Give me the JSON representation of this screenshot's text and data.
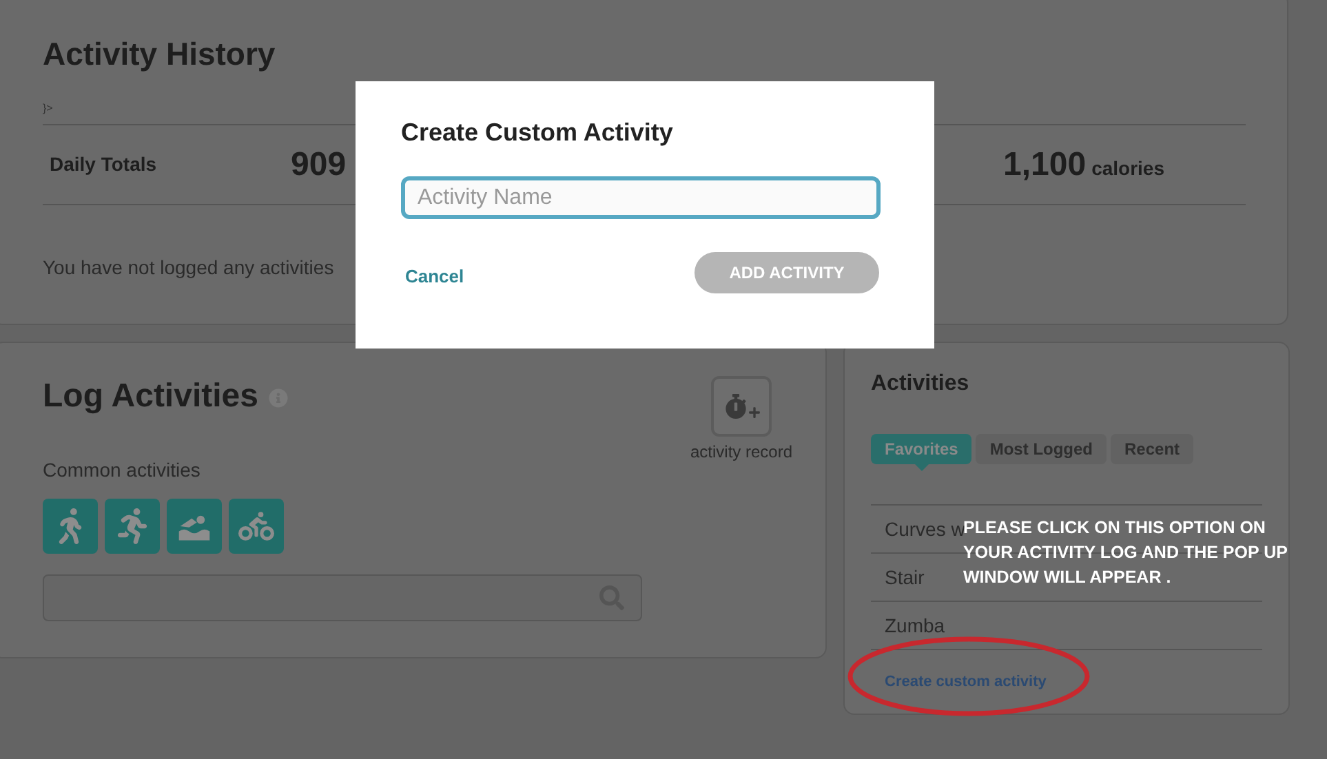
{
  "history": {
    "title": "Activity History",
    "breadcrumb": "}>",
    "totals_label": "Daily Totals",
    "totals": [
      {
        "value": "909"
      },
      {
        "value": "1,100",
        "unit": "calories"
      }
    ],
    "empty_message": "You have not logged any activities"
  },
  "log": {
    "title": "Log Activities",
    "record_label": "activity record",
    "common_label": "Common activities",
    "common": [
      {
        "kind": "walk"
      },
      {
        "kind": "run"
      },
      {
        "kind": "swim"
      },
      {
        "kind": "bike"
      }
    ]
  },
  "activities": {
    "title": "Activities",
    "tabs": [
      {
        "label": "Favorites",
        "selected": true
      },
      {
        "label": "Most Logged",
        "selected": false
      },
      {
        "label": "Recent",
        "selected": false
      }
    ],
    "items": [
      "Curves w",
      "Stair",
      "Zumba"
    ],
    "create_link": "Create custom activity"
  },
  "modal": {
    "title": "Create Custom Activity",
    "placeholder": "Activity Name",
    "cancel": "Cancel",
    "submit": "ADD ACTIVITY",
    "submit_disabled": true
  },
  "annotation": {
    "note": "PLEASE CLICK ON THIS OPTION ON YOUR ACTIVITY LOG AND THE POP UP WINDOW WILL APPEAR ."
  }
}
